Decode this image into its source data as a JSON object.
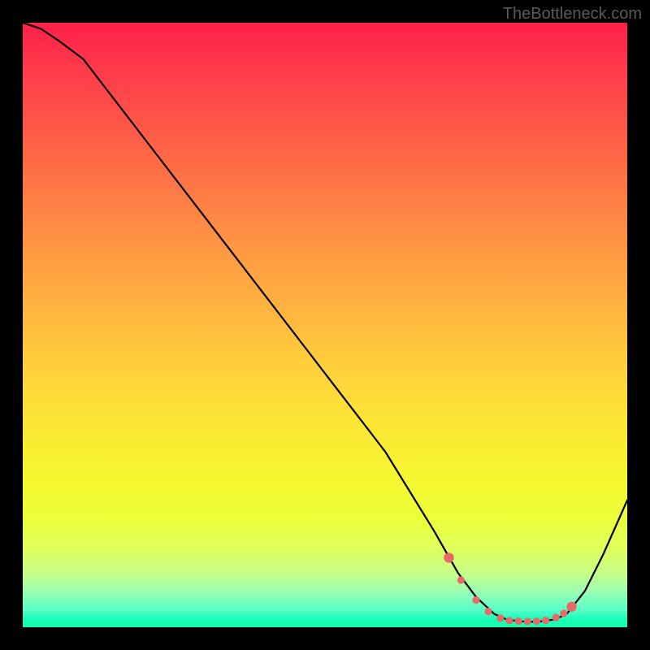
{
  "watermark": "TheBottleneck.com",
  "chart_data": {
    "type": "line",
    "title": "",
    "xlabel": "",
    "ylabel": "",
    "xlim": [
      0,
      100
    ],
    "ylim": [
      0,
      100
    ],
    "series": [
      {
        "name": "bottleneck-curve",
        "x": [
          0,
          3,
          6,
          10,
          20,
          30,
          40,
          50,
          60,
          68,
          72,
          75,
          78,
          80,
          82,
          84,
          86,
          88,
          90,
          93,
          96,
          100
        ],
        "y": [
          100,
          99,
          97,
          94,
          81,
          68,
          55,
          42,
          29,
          16,
          9,
          5,
          2.2,
          1.3,
          1.0,
          0.9,
          1.0,
          1.3,
          2.2,
          6,
          12,
          21
        ]
      }
    ],
    "markers": {
      "name": "marker-dots",
      "x": [
        70.5,
        72.5,
        75,
        77,
        79,
        80.5,
        82,
        83.5,
        85,
        86.5,
        88.2,
        89.5,
        90.8
      ],
      "y": [
        11.5,
        7.8,
        4.5,
        2.6,
        1.5,
        1.1,
        1.0,
        0.95,
        1.0,
        1.15,
        1.6,
        2.3,
        3.4
      ]
    },
    "gradient_stops": [
      {
        "pos": 0,
        "color": "#ff1f4b"
      },
      {
        "pos": 0.5,
        "color": "#ffd33a"
      },
      {
        "pos": 0.85,
        "color": "#ecff3a"
      },
      {
        "pos": 1.0,
        "color": "#0effaa"
      }
    ]
  }
}
